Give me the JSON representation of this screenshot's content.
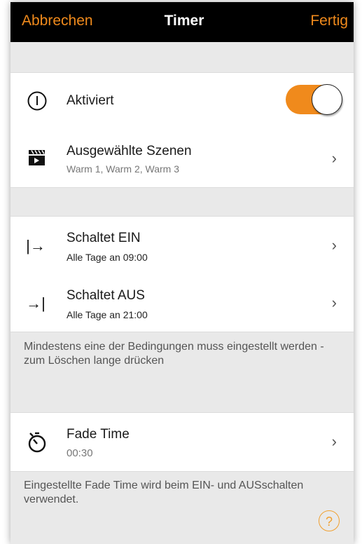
{
  "header": {
    "cancel_label": "Abbrechen",
    "title": "Timer",
    "done_label": "Fertig"
  },
  "activated": {
    "label": "Aktiviert",
    "toggle_on": true
  },
  "scenes": {
    "title": "Ausgewählte Szenen",
    "subtitle": "Warm 1, Warm 2, Warm 3"
  },
  "switch_on": {
    "icon_text": "|→",
    "title": "Schaltet EIN",
    "subtitle": "Alle Tage an 09:00"
  },
  "switch_off": {
    "icon_text": "→|",
    "title": "Schaltet AUS",
    "subtitle": "Alle Tage an 21:00"
  },
  "conditions_note": "Mindestens eine der Bedingungen muss eingestellt werden - zum Löschen lange drücken",
  "fade": {
    "title": "Fade Time",
    "subtitle": "00:30"
  },
  "fade_note": "Eingestellte Fade Time wird beim EIN- und AUSschalten verwendet.",
  "help_label": "?",
  "chevron": "›",
  "colors": {
    "accent": "#f08a1c",
    "header_bg": "#000000",
    "page_bg": "#e9e9e9"
  }
}
